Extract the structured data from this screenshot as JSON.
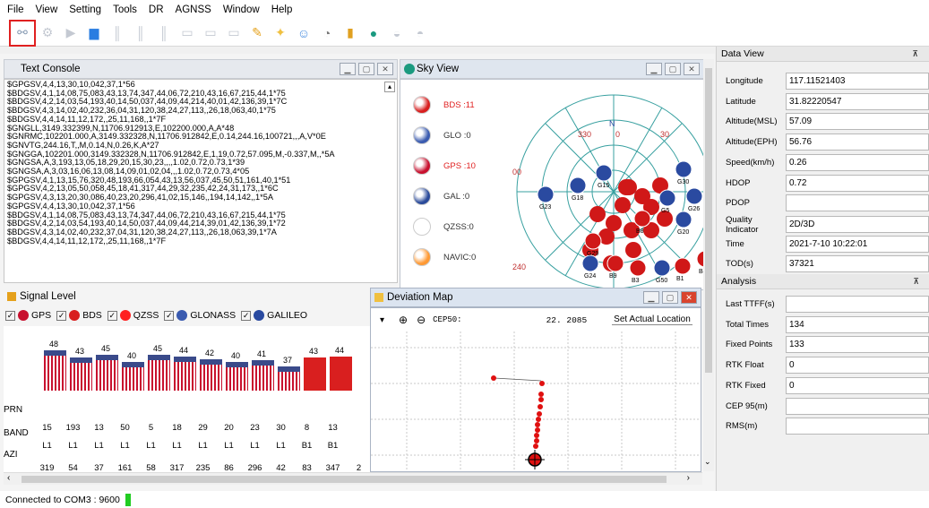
{
  "menu": [
    "File",
    "View",
    "Setting",
    "Tools",
    "DR",
    "AGNSS",
    "Window",
    "Help"
  ],
  "console": {
    "title": "Text Console",
    "lines": [
      "$GPGSV,4,4,13,30,10,042,37,1*56",
      "$BDGSV,4,1,14,08,75,083,43,13,74,347,44,06,72,210,43,16,67,215,44,1*75",
      "$BDGSV,4,2,14,03,54,193,40,14,50,037,44,09,44,214,40,01,42,136,39,1*7C",
      "$BDGSV,4,3,14,02,40,232,36,04,31,120,38,24,27,113,,26,18,063,40,1*75",
      "$BDGSV,4,4,14,11,12,172,,25,11,168,,1*7F",
      "$GNGLL,3149.332399,N,11706.912913,E,102200.000,A,A*48",
      "$GNRMC,102201.000,A,3149.332328,N,11706.912842,E,0.14,244.16,100721,,,A,V*0E",
      "$GNVTG,244.16,T,,M,0.14,N,0.26,K,A*27",
      "$GNGGA,102201.000,3149.332328,N,11706.912842,E,1,19,0.72,57.095,M,-0.337,M,,*5A",
      "$GNGSA,A,3,193,13,05,18,29,20,15,30,23,,,,1.02,0.72,0.73,1*39",
      "$GNGSA,A,3,03,16,06,13,08,14,09,01,02,04,,,1.02,0.72,0.73,4*05",
      "$GPGSV,4,1,13,15,76,320,48,193,66,054,43,13,56,037,45,50,51,161,40,1*51",
      "$GPGSV,4,2,13,05,50,058,45,18,41,317,44,29,32,235,42,24,31,173,,1*6C",
      "$GPGSV,4,3,13,20,30,086,40,23,20,296,41,02,15,146,,194,14,142,,1*5A",
      "$GPGSV,4,4,13,30,10,042,37,1*56",
      "$BDGSV,4,1,14,08,75,083,43,13,74,347,44,06,72,210,43,16,67,215,44,1*75",
      "$BDGSV,4,2,14,03,54,193,40,14,50,037,44,09,44,214,39,01,42,136,39,1*72",
      "$BDGSV,4,3,14,02,40,232,37,04,31,120,38,24,27,113,,26,18,063,39,1*7A",
      "$BDGSV,4,4,14,11,12,172,,25,11,168,,1*7F"
    ]
  },
  "sky": {
    "title": "Sky View",
    "legend": [
      {
        "label": "BDS :11",
        "color": "#e02020",
        "flag": "#d81e1e"
      },
      {
        "label": "GLO :0",
        "color": "#333",
        "flag": "#3a5bb0"
      },
      {
        "label": "GPS :10",
        "color": "#e02020",
        "flag": "#c8102e"
      },
      {
        "label": "GAL :0",
        "color": "#333",
        "flag": "#2a4a9a"
      },
      {
        "label": "QZSS:0",
        "color": "#333",
        "flag": "#ffffff"
      },
      {
        "label": "NAVIC:0",
        "color": "#333",
        "flag": "#ff9933"
      }
    ],
    "compass": {
      "n": "N",
      "deg330": "330",
      "deg0": "0",
      "deg30": "30",
      "deg00": "00",
      "deg240": "240"
    },
    "sats": [
      "G23",
      "G18",
      "G15",
      "G30",
      "G26",
      "G5",
      "G20",
      "B8",
      "G24",
      "B9",
      "B3",
      "G50",
      "B1",
      "B4",
      "G29"
    ]
  },
  "signal": {
    "title": "Signal Level",
    "filters": [
      "GPS",
      "BDS",
      "QZSS",
      "GLONASS",
      "GALILEO"
    ],
    "snr": [
      "48",
      "43",
      "45",
      "40",
      "45",
      "44",
      "42",
      "40",
      "41",
      "37",
      "43",
      "44"
    ],
    "snr_values": [
      48,
      43,
      45,
      40,
      45,
      44,
      42,
      40,
      41,
      37,
      43,
      44
    ],
    "bar_types": [
      "gps",
      "gps",
      "gps",
      "gps",
      "gps",
      "gps",
      "gps",
      "gps",
      "gps",
      "gps",
      "bds",
      "bds"
    ],
    "prn_label": "PRN",
    "prn": [
      "15",
      "193",
      "13",
      "50",
      "5",
      "18",
      "29",
      "20",
      "23",
      "30",
      "8",
      "13"
    ],
    "band_label": "BAND",
    "band": [
      "L1",
      "L1",
      "L1",
      "L1",
      "L1",
      "L1",
      "L1",
      "L1",
      "L1",
      "L1",
      "B1",
      "B1"
    ],
    "azi_label": "AZI",
    "azi": [
      "319",
      "54",
      "37",
      "161",
      "58",
      "317",
      "235",
      "86",
      "296",
      "42",
      "83",
      "347",
      "2"
    ]
  },
  "deviation": {
    "title": "Deviation Map",
    "cep_label": "CEP50:",
    "cep_value": "22. 2085",
    "button": "Set Actual Location"
  },
  "dataview": {
    "title": "Data View",
    "rows": [
      {
        "label": "Longitude",
        "value": "117.11521403"
      },
      {
        "label": "Latitude",
        "value": "31.82220547"
      },
      {
        "label": "Altitude(MSL)",
        "value": "57.09"
      },
      {
        "label": "Altitude(EPH)",
        "value": "56.76"
      },
      {
        "label": "Speed(km/h)",
        "value": "0.26"
      },
      {
        "label": "HDOP",
        "value": "0.72"
      },
      {
        "label": "PDOP",
        "value": ""
      },
      {
        "label": "Quality Indicator",
        "value": "2D/3D"
      },
      {
        "label": "Time",
        "value": "2021-7-10 10:22:01"
      },
      {
        "label": "TOD(s)",
        "value": "37321"
      }
    ]
  },
  "analysis": {
    "title": "Analysis",
    "rows": [
      {
        "label": "Last TTFF(s)",
        "value": ""
      },
      {
        "label": "Total Times",
        "value": "134"
      },
      {
        "label": "Fixed Points",
        "value": "133"
      },
      {
        "label": "RTK Float",
        "value": "0"
      },
      {
        "label": "RTK Fixed",
        "value": "0"
      },
      {
        "label": "CEP 95(m)",
        "value": ""
      },
      {
        "label": "RMS(m)",
        "value": ""
      }
    ]
  },
  "status": "Connected to COM3 : 9600"
}
